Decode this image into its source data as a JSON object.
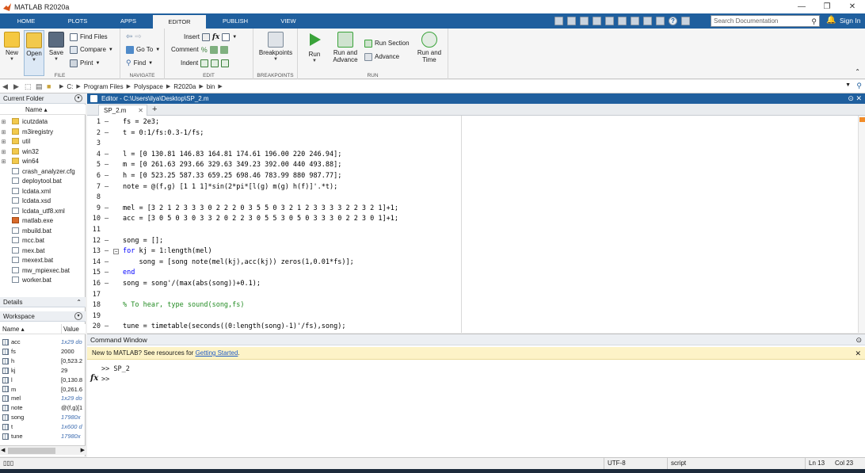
{
  "window": {
    "title": "MATLAB R2020a",
    "controls": [
      "minimize",
      "restore",
      "close"
    ]
  },
  "tabs": [
    {
      "label": "HOME"
    },
    {
      "label": "PLOTS"
    },
    {
      "label": "APPS"
    },
    {
      "label": "EDITOR",
      "active": true
    },
    {
      "label": "PUBLISH"
    },
    {
      "label": "VIEW"
    }
  ],
  "search": {
    "placeholder": "Search Documentation"
  },
  "signin": "Sign In",
  "ribbon": {
    "file": {
      "label": "FILE",
      "new": "New",
      "open": "Open",
      "save": "Save",
      "find_files": "Find Files",
      "compare": "Compare",
      "print": "Print"
    },
    "navigate": {
      "label": "NAVIGATE",
      "goto": "Go To",
      "find": "Find"
    },
    "edit": {
      "label": "EDIT",
      "insert": "Insert",
      "comment": "Comment",
      "indent": "Indent"
    },
    "breakpoints": {
      "label": "BREAKPOINTS",
      "breakpoints": "Breakpoints"
    },
    "run": {
      "label": "RUN",
      "run": "Run",
      "run_advance_1": "Run and",
      "run_advance_2": "Advance",
      "run_section": "Run Section",
      "advance": "Advance",
      "run_time_1": "Run and",
      "run_time_2": "Time"
    }
  },
  "address": {
    "crumbs": [
      "C:",
      "Program Files",
      "Polyspace",
      "R2020a",
      "bin"
    ]
  },
  "current_folder": {
    "title": "Current Folder",
    "col_name": "Name ▴",
    "items": [
      {
        "name": "icutzdata",
        "type": "folder"
      },
      {
        "name": "m3iregistry",
        "type": "folder"
      },
      {
        "name": "util",
        "type": "folder"
      },
      {
        "name": "win32",
        "type": "folder"
      },
      {
        "name": "win64",
        "type": "folder"
      },
      {
        "name": "crash_analyzer.cfg",
        "type": "file"
      },
      {
        "name": "deploytool.bat",
        "type": "file"
      },
      {
        "name": "lcdata.xml",
        "type": "file"
      },
      {
        "name": "lcdata.xsd",
        "type": "file"
      },
      {
        "name": "lcdata_utf8.xml",
        "type": "file"
      },
      {
        "name": "matlab.exe",
        "type": "exe"
      },
      {
        "name": "mbuild.bat",
        "type": "file"
      },
      {
        "name": "mcc.bat",
        "type": "file"
      },
      {
        "name": "mex.bat",
        "type": "file"
      },
      {
        "name": "mexext.bat",
        "type": "file"
      },
      {
        "name": "mw_mpiexec.bat",
        "type": "file"
      },
      {
        "name": "worker.bat",
        "type": "file"
      }
    ]
  },
  "details": {
    "title": "Details"
  },
  "workspace": {
    "title": "Workspace",
    "col_name": "Name ▴",
    "col_value": "Value",
    "vars": [
      {
        "name": "acc",
        "value": "1x29 do",
        "italic": true
      },
      {
        "name": "fs",
        "value": "2000",
        "italic": false
      },
      {
        "name": "h",
        "value": "[0,523.2",
        "italic": false
      },
      {
        "name": "kj",
        "value": "29",
        "italic": false
      },
      {
        "name": "l",
        "value": "[0,130.8",
        "italic": false
      },
      {
        "name": "m",
        "value": "[0,261.6",
        "italic": false
      },
      {
        "name": "mel",
        "value": "1x29 do",
        "italic": true
      },
      {
        "name": "note",
        "value": "@(f,g)[1",
        "italic": false
      },
      {
        "name": "song",
        "value": "17980x",
        "italic": true
      },
      {
        "name": "t",
        "value": "1x600 d",
        "italic": true
      },
      {
        "name": "tune",
        "value": "17980x",
        "italic": true
      }
    ]
  },
  "editor": {
    "title": "Editor - C:\\Users\\ilya\\Desktop\\SP_2.m",
    "tab": "SP_2.m",
    "lines": [
      {
        "n": "1",
        "dash": "–",
        "text": "fs = 2e3;"
      },
      {
        "n": "2",
        "dash": "–",
        "text": "t = 0:1/fs:0.3-1/fs;"
      },
      {
        "n": "3",
        "dash": "",
        "text": ""
      },
      {
        "n": "4",
        "dash": "–",
        "text": "l = [0 130.81 146.83 164.81 174.61 196.00 220 246.94];"
      },
      {
        "n": "5",
        "dash": "–",
        "text": "m = [0 261.63 293.66 329.63 349.23 392.00 440 493.88];"
      },
      {
        "n": "6",
        "dash": "–",
        "text": "h = [0 523.25 587.33 659.25 698.46 783.99 880 987.77];"
      },
      {
        "n": "7",
        "dash": "–",
        "text": "note = @(f,g) [1 1 1]*sin(2*pi*[l(g) m(g) h(f)]'.*t);"
      },
      {
        "n": "8",
        "dash": "",
        "text": ""
      },
      {
        "n": "9",
        "dash": "–",
        "text": "mel = [3 2 1 2 3 3 3 0 2 2 2 0 3 5 5 0 3 2 1 2 3 3 3 3 2 2 3 2 1]+1;"
      },
      {
        "n": "10",
        "dash": "–",
        "text": "acc = [3 0 5 0 3 0 3 3 2 0 2 2 3 0 5 5 3 0 5 0 3 3 3 0 2 2 3 0 1]+1;"
      },
      {
        "n": "11",
        "dash": "",
        "text": ""
      },
      {
        "n": "12",
        "dash": "–",
        "text": "song = [];"
      },
      {
        "n": "13",
        "dash": "–",
        "kw": "for",
        "text": " kj = 1:length(mel)"
      },
      {
        "n": "14",
        "dash": "–",
        "text": "    song = [song note(mel(kj),acc(kj)) zeros(1,0.01*fs)];"
      },
      {
        "n": "15",
        "dash": "–",
        "kw": "end",
        "text": ""
      },
      {
        "n": "16",
        "dash": "–",
        "text": "song = song'/(max(abs(song))+0.1);"
      },
      {
        "n": "17",
        "dash": "",
        "text": ""
      },
      {
        "n": "18",
        "dash": "",
        "comment": true,
        "text": "% To hear, type sound(song,fs)"
      },
      {
        "n": "19",
        "dash": "",
        "text": ""
      },
      {
        "n": "20",
        "dash": "–",
        "text": "tune = timetable(seconds((0:length(song)-1)'/fs),song);"
      }
    ]
  },
  "command_window": {
    "title": "Command Window",
    "banner_text": "New to MATLAB? See resources for ",
    "banner_link": "Getting Started",
    "banner_end": ".",
    "history": ">> SP_2",
    "prompt": ">>",
    "fx": "fx"
  },
  "status": {
    "encoding": "UTF-8",
    "type": "script",
    "ln": "Ln  13",
    "col": "Col  23"
  },
  "colors": {
    "accent": "#1f5f9e",
    "keyword": "#0000ff",
    "comment": "#228b22",
    "banner": "#fdf3c7"
  }
}
